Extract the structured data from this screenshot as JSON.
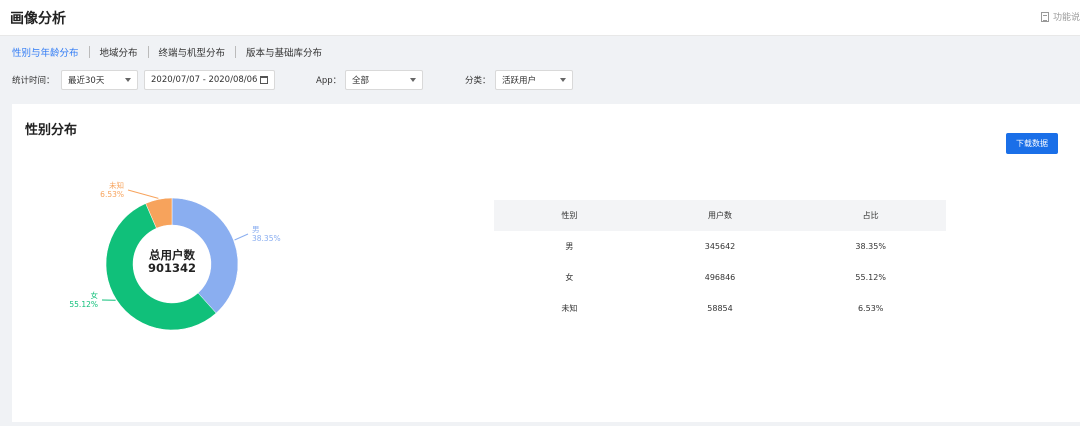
{
  "header": {
    "title": "画像分析",
    "help_label": "功能说"
  },
  "tabs": [
    {
      "label": "性别与年龄分布",
      "active": true
    },
    {
      "label": "地域分布"
    },
    {
      "label": "终端与机型分布"
    },
    {
      "label": "版本与基础库分布"
    }
  ],
  "filters": {
    "time_label": "统计时间：",
    "time_range": "最近30天",
    "date_range": "2020/07/07 - 2020/08/06",
    "app_label": "App：",
    "app_value": "全部",
    "category_label": "分类：",
    "category_value": "活跃用户"
  },
  "card": {
    "title": "性别分布",
    "download_label": "下载数据"
  },
  "donut": {
    "center_title": "总用户数",
    "center_value": "901342",
    "colors": {
      "male": "#8aaef0",
      "female": "#10c07a",
      "unknown": "#f7a35c"
    }
  },
  "chart_data": {
    "type": "pie",
    "series": [
      {
        "name": "男",
        "value": 345642,
        "percent": "38.35%"
      },
      {
        "name": "女",
        "value": 496846,
        "percent": "55.12%"
      },
      {
        "name": "未知",
        "value": 58854,
        "percent": "6.53%"
      }
    ]
  },
  "table": {
    "headers": [
      "性别",
      "用户数",
      "占比"
    ],
    "rows": [
      [
        "男",
        "345642",
        "38.35%"
      ],
      [
        "女",
        "496846",
        "55.12%"
      ],
      [
        "未知",
        "58854",
        "6.53%"
      ]
    ]
  }
}
